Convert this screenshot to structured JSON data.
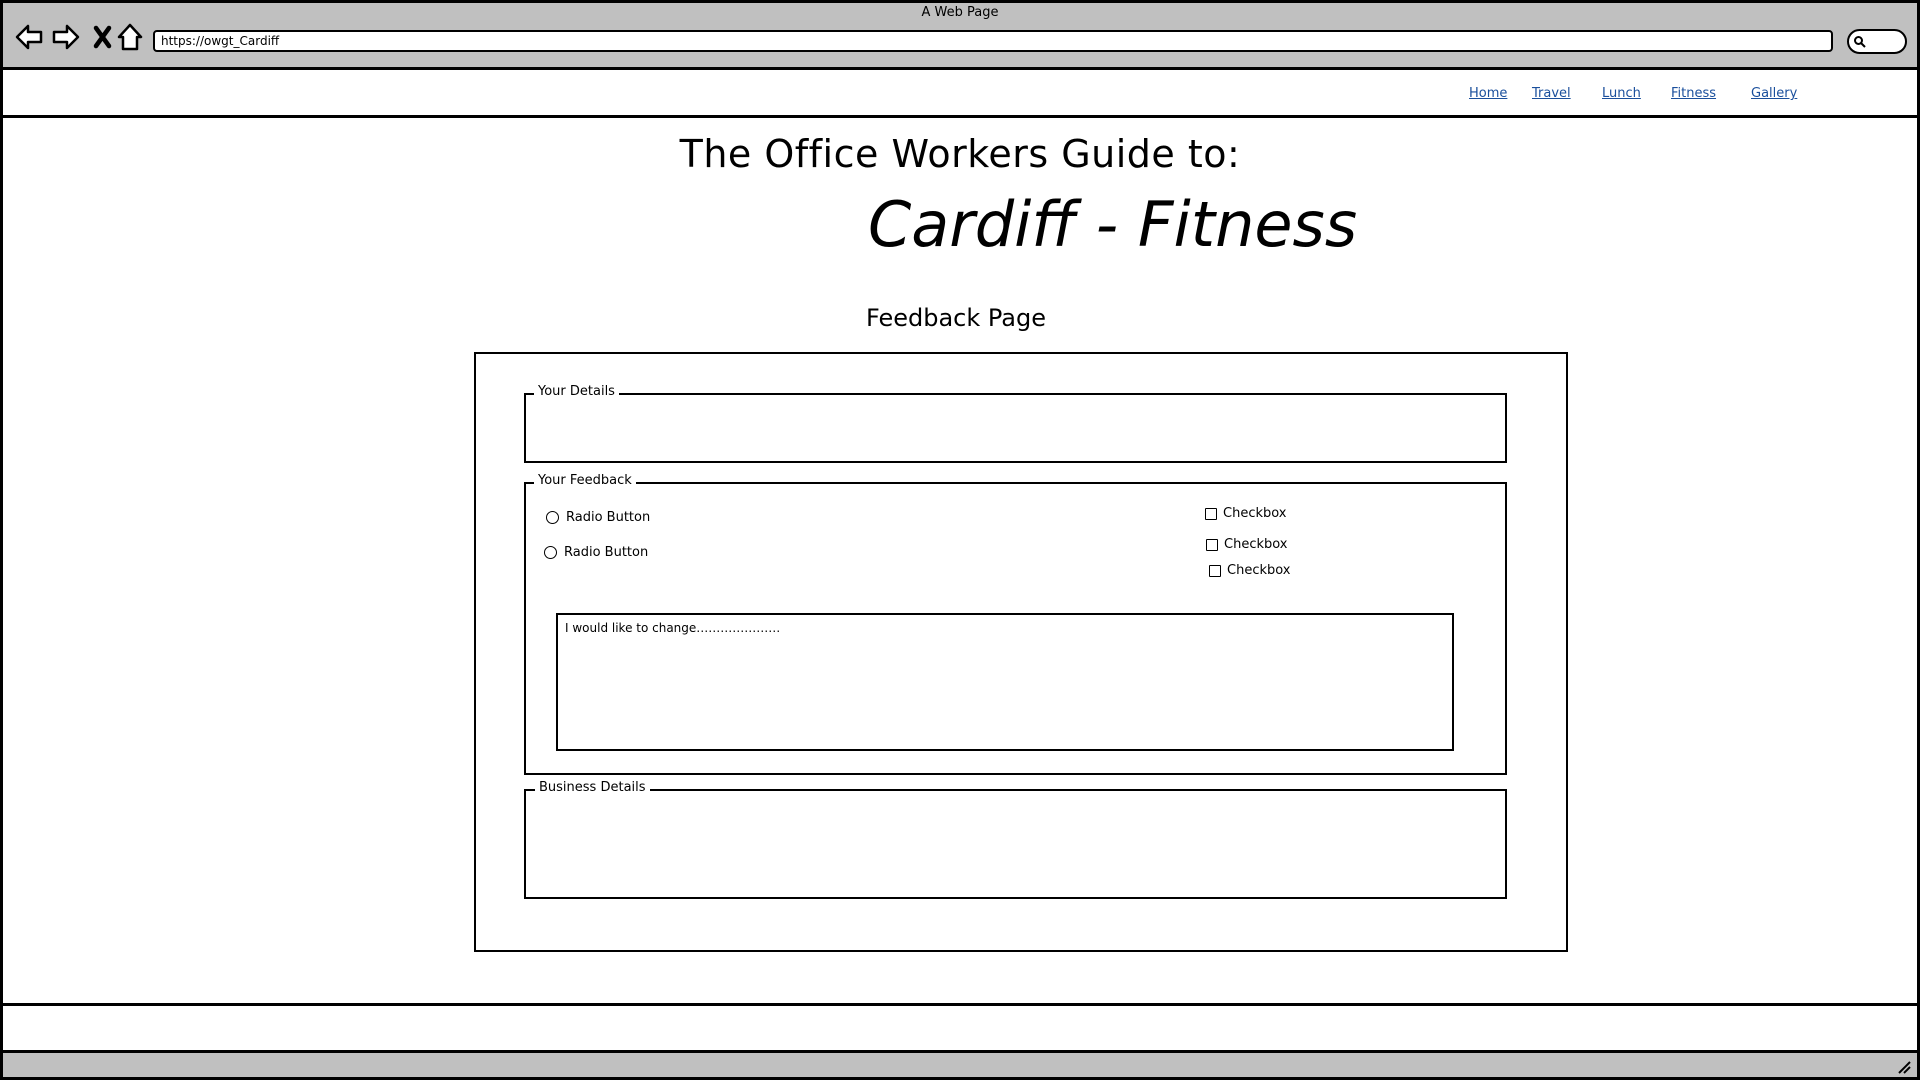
{
  "window": {
    "title": "A Web Page",
    "url": "https://owgt_Cardiff"
  },
  "nav": {
    "links": [
      "Home",
      "Travel",
      "Lunch",
      "Fitness",
      "Gallery"
    ],
    "link_color": "#1a4f9c"
  },
  "header": {
    "title": "The Office Workers Guide to:",
    "subtitle": "Cardiff - Fitness"
  },
  "page": {
    "title": "Feedback Page"
  },
  "form": {
    "your_details_legend": "Your Details",
    "your_feedback_legend": "Your Feedback",
    "business_details_legend": "Business Details",
    "radios": [
      "Radio Button",
      "Radio Button"
    ],
    "checkboxes": [
      "Checkbox",
      "Checkbox",
      "Checkbox"
    ],
    "comment_value": "I would like to change…………………"
  },
  "icons": {
    "back": "back-arrow-icon",
    "forward": "forward-arrow-icon",
    "stop": "close-icon",
    "home": "home-icon",
    "search": "search-icon",
    "resize": "resize-grip-icon"
  }
}
